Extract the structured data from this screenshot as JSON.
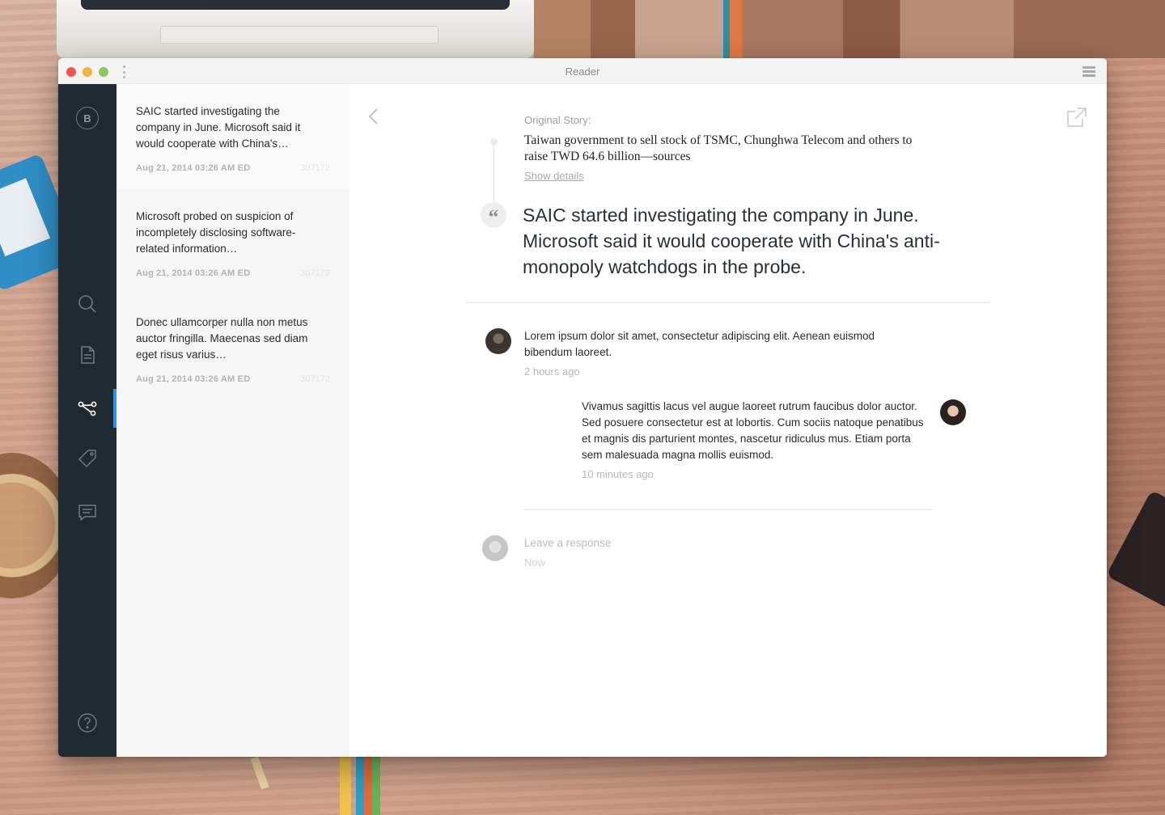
{
  "window": {
    "title": "Reader"
  },
  "nav": {
    "logo_letter": "B",
    "items": [
      {
        "name": "search",
        "icon": "search-icon"
      },
      {
        "name": "documents",
        "icon": "document-icon"
      },
      {
        "name": "connections",
        "icon": "share-nodes-icon",
        "active": true
      },
      {
        "name": "tags",
        "icon": "tag-icon"
      },
      {
        "name": "comments",
        "icon": "comment-icon"
      },
      {
        "name": "help",
        "icon": "help-icon"
      }
    ],
    "accent_color": "#2f8fe0"
  },
  "list": {
    "items": [
      {
        "text": "SAIC started investigating the company in June. Microsoft said it would cooperate with China's…",
        "date": "Aug 21, 2014 03:26 AM ED",
        "id": "307172"
      },
      {
        "text": "Microsoft probed on suspicion of incompletely disclosing software-related information…",
        "date": "Aug 21, 2014 03:26 AM ED",
        "id": "307172"
      },
      {
        "text": "Donec ullamcorper nulla non metus auctor fringilla. Maecenas sed diam eget risus varius…",
        "date": "Aug 21, 2014 03:26 AM ED",
        "id": "307172"
      }
    ]
  },
  "reader": {
    "original_label": "Original Story:",
    "original_title": "Taiwan government to sell stock of TSMC, Chunghwa Telecom and others to raise TWD 64.6 billion—sources",
    "show_details": "Show details",
    "quote_mark": "“",
    "quote": "SAIC started investigating the company in June. Microsoft said it would cooperate with China's anti-monopoly watchdogs in the probe.",
    "comments": [
      {
        "text": "Lorem ipsum dolor sit amet, consectetur adipiscing elit. Aenean euismod bibendum laoreet.",
        "time": "2 hours ago"
      },
      {
        "text": "Vivamus sagittis lacus vel augue laoreet rutrum faucibus dolor auctor. Sed posuere consectetur est at lobortis. Cum sociis natoque penatibus et magnis dis parturient montes, nascetur ridiculus mus. Etiam porta sem malesuada magna mollis euismod.",
        "time": "10 minutes ago"
      }
    ],
    "response": {
      "placeholder": "Leave a response",
      "time": "Now"
    }
  }
}
